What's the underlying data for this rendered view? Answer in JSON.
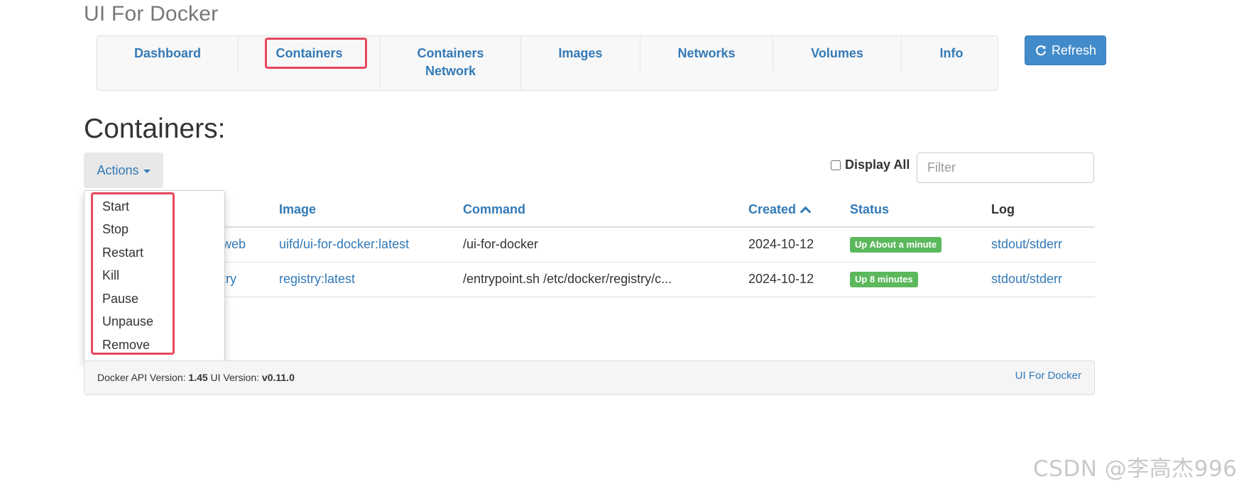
{
  "brand": "UI For Docker",
  "nav": {
    "items": [
      {
        "label": "Dashboard"
      },
      {
        "label": "Containers"
      },
      {
        "label": "Containers Network"
      },
      {
        "label": "Images"
      },
      {
        "label": "Networks"
      },
      {
        "label": "Volumes"
      },
      {
        "label": "Info"
      }
    ],
    "active": "Containers",
    "refresh_label": "Refresh",
    "refresh_icon": "refresh-icon"
  },
  "page": {
    "title": "Containers:",
    "actions_label": "Actions",
    "display_all_label": "Display All",
    "display_all_checked": false,
    "filter_placeholder": "Filter"
  },
  "actions_menu": {
    "items": [
      "Start",
      "Stop",
      "Restart",
      "Kill",
      "Pause",
      "Unpause",
      "Remove"
    ]
  },
  "table": {
    "headers": {
      "image": "Image",
      "command": "Command",
      "created": "Created",
      "status": "Status",
      "log": "Log"
    },
    "sort_icon": "chevron-up-icon",
    "rows": [
      {
        "name_visible": "web",
        "image": "uifd/ui-for-docker:latest",
        "command": "/ui-for-docker",
        "created": "2024-10-12",
        "status": "Up About a minute",
        "log": "stdout/stderr"
      },
      {
        "name_visible": "try",
        "image": "registry:latest",
        "command": "/entrypoint.sh /etc/docker/registry/c...",
        "created": "2024-10-12",
        "status": "Up 8 minutes",
        "log": "stdout/stderr"
      }
    ]
  },
  "footer": {
    "api_label": "Docker API Version:",
    "api_version": "1.45",
    "ui_label": "UI Version:",
    "ui_version": "v0.11.0",
    "link": "UI For Docker"
  },
  "watermark": "CSDN @李高杰996",
  "colors": {
    "link": "#337ab7",
    "highlight": "#e8475c",
    "badge_success": "#5cb85c",
    "refresh_button": "#428bca"
  }
}
